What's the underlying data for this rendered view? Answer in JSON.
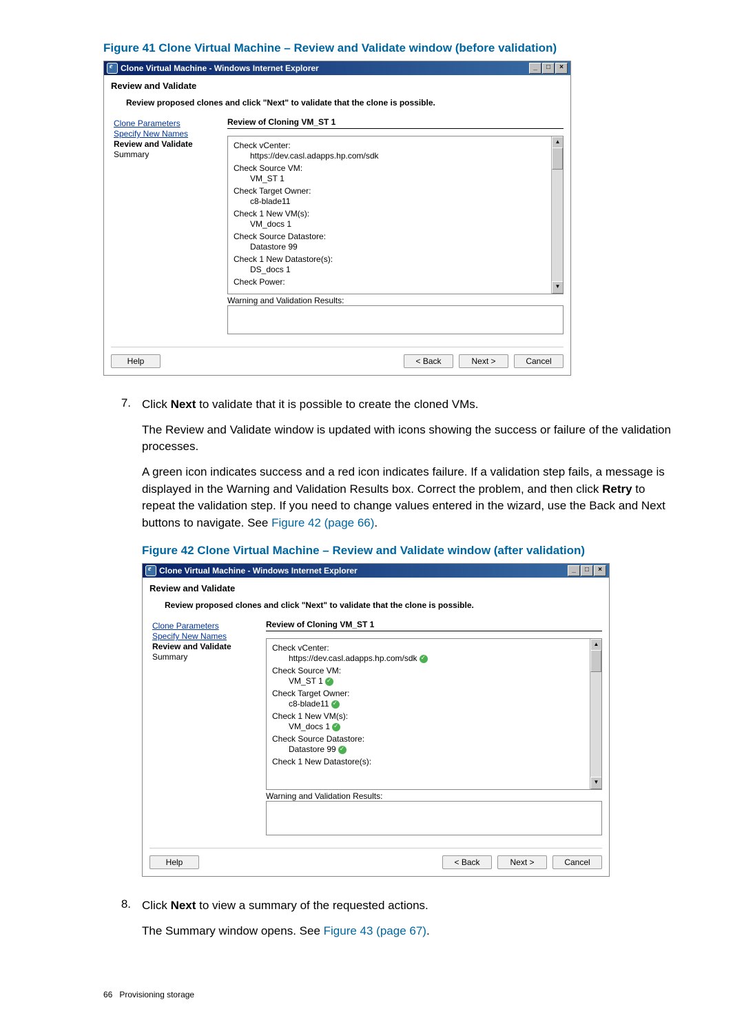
{
  "figure41_caption": "Figure 41 Clone Virtual Machine – Review and Validate window (before validation)",
  "figure42_caption": "Figure 42 Clone Virtual Machine – Review and Validate window (after validation)",
  "dialog": {
    "title": "Clone Virtual Machine - Windows Internet Explorer",
    "heading": "Review and Validate",
    "instruction": "Review proposed clones and click \"Next\" to validate that the clone is possible.",
    "steps": {
      "clone_parameters": "Clone Parameters",
      "specify_new_names": "Specify New Names",
      "review_and_validate": "Review and Validate",
      "summary": "Summary"
    },
    "review_title": "Review of Cloning VM_ST 1",
    "checks": {
      "vcenter_label": "Check vCenter:",
      "vcenter_value": "https://dev.casl.adapps.hp.com/sdk",
      "source_vm_label": "Check Source VM:",
      "source_vm_value": "VM_ST 1",
      "target_owner_label": "Check Target Owner:",
      "target_owner_value": "c8-blade11",
      "new_vms_label": "Check 1 New VM(s):",
      "new_vms_value": "VM_docs 1",
      "source_ds_label": "Check Source Datastore:",
      "source_ds_value": "Datastore 99",
      "new_ds_label": "Check 1 New Datastore(s):",
      "new_ds_value": "DS_docs 1",
      "power_label": "Check Power:"
    },
    "warning_results_label": "Warning and Validation Results:",
    "buttons": {
      "help": "Help",
      "back": "< Back",
      "next": "Next >",
      "cancel": "Cancel"
    }
  },
  "body": {
    "step7_num": "7.",
    "step7_line1a": "Click ",
    "step7_line1_bold": "Next",
    "step7_line1b": " to validate that it is possible to create the cloned VMs.",
    "step7_line2": "The Review and Validate window is updated with icons showing the success or failure of the validation processes.",
    "step7_line3a": "A green icon indicates success and a red icon indicates failure. If a validation step fails, a message is displayed in the Warning and Validation Results box. Correct the problem, and then click ",
    "step7_line3_bold": "Retry",
    "step7_line3b": " to repeat the validation step. If you need to change values entered in the wizard, use the Back and Next buttons to navigate. See ",
    "step7_line3_link": "Figure 42 (page 66)",
    "step7_line3c": ".",
    "step8_num": "8.",
    "step8_line1a": "Click ",
    "step8_line1_bold": "Next",
    "step8_line1b": " to view a summary of the requested actions.",
    "step8_line2a": "The Summary window opens. See ",
    "step8_line2_link": "Figure 43 (page 67)",
    "step8_line2b": "."
  },
  "footer": {
    "page_num": "66",
    "section": "Provisioning storage"
  }
}
